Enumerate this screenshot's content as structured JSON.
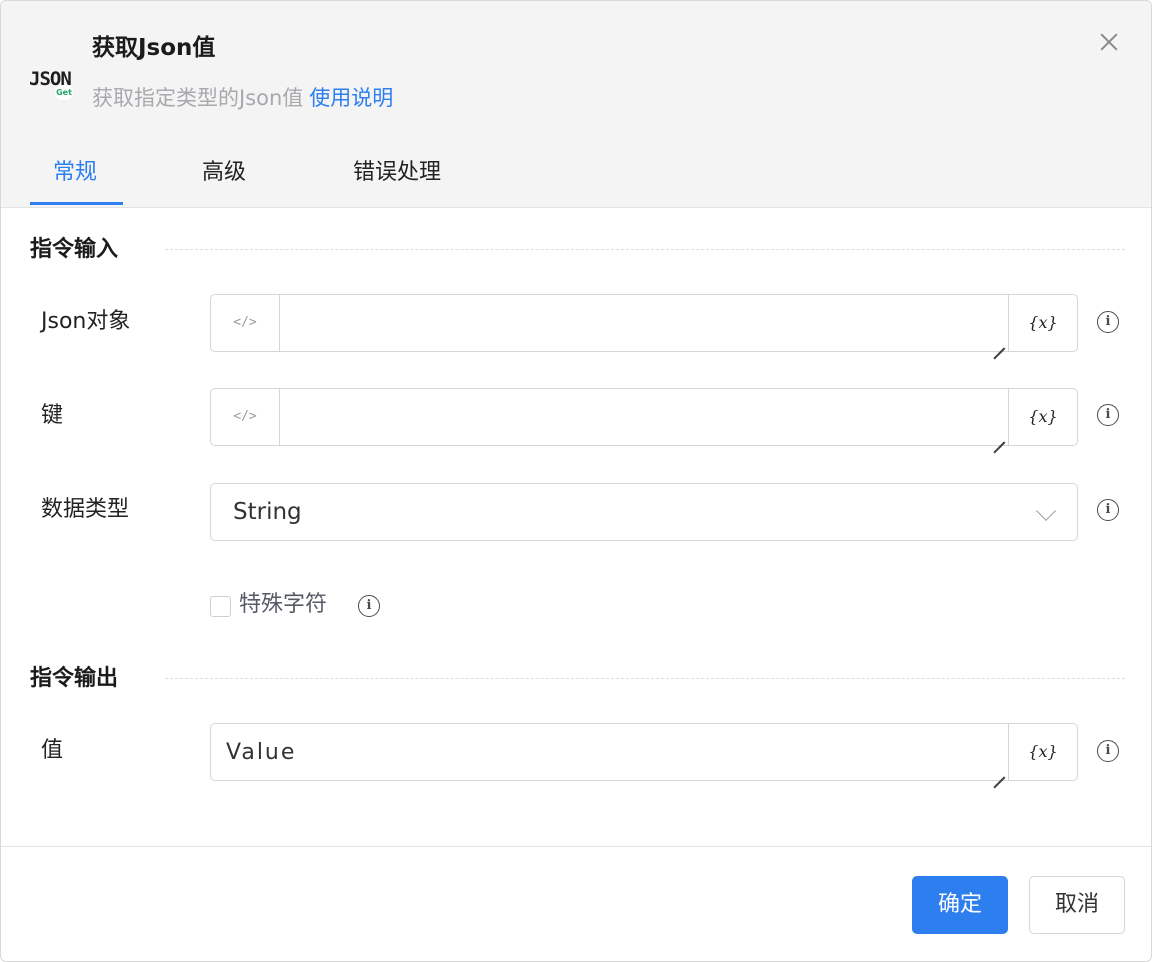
{
  "header": {
    "logo_text": "JSON",
    "logo_badge": "Get",
    "title": "获取Json值",
    "subtitle": "获取指定类型的Json值",
    "help_link": "使用说明"
  },
  "tabs": [
    {
      "label": "常规",
      "active": true
    },
    {
      "label": "高级",
      "active": false
    },
    {
      "label": "错误处理",
      "active": false
    }
  ],
  "input_section": {
    "title": "指令输入",
    "fields": {
      "json_object": {
        "label": "Json对象",
        "value": ""
      },
      "key": {
        "label": "键",
        "value": ""
      },
      "data_type": {
        "label": "数据类型",
        "selected": "String"
      }
    },
    "special_chars": {
      "label": "特殊字符",
      "checked": false
    }
  },
  "output_section": {
    "title": "指令输出",
    "fields": {
      "value": {
        "label": "值",
        "value": "Value"
      }
    }
  },
  "icons": {
    "code": "</>",
    "variable": "{x}",
    "info": "i"
  },
  "footer": {
    "confirm_label": "确定",
    "cancel_label": "取消"
  },
  "colors": {
    "accent": "#2d7ff0",
    "header_bg": "#f4f4f5",
    "badge_green": "#21a366"
  }
}
